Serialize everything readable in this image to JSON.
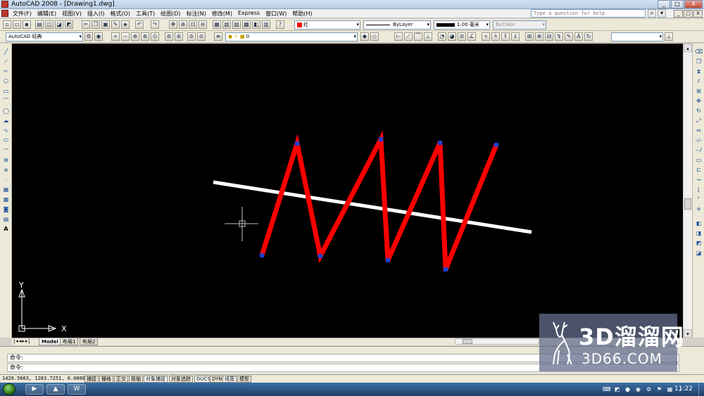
{
  "window": {
    "title": "AutoCAD 2008 - [Drawing1.dwg]",
    "controls": [
      "_",
      "□",
      "X"
    ],
    "mdi_controls": [
      "_",
      "□",
      "X"
    ]
  },
  "menu": {
    "items": [
      "文件(F)",
      "编辑(E)",
      "视图(V)",
      "插入(I)",
      "格式(O)",
      "工具(T)",
      "绘图(D)",
      "标注(N)",
      "修改(M)",
      "Express",
      "窗口(W)",
      "帮助(H)"
    ],
    "help_placeholder": "Type a question for help"
  },
  "toolbar_properties": {
    "color": "红",
    "color_hex": "#ff0000",
    "linetype": "ByLayer",
    "lineweight": "1.00 毫米",
    "plotstyle": "ByColor"
  },
  "toolbar_workspace": {
    "workspace": "AutoCAD 经典",
    "layer": "0"
  },
  "layout_tabs": [
    "Model",
    "布局1",
    "布局2"
  ],
  "command": {
    "line1": "命令:",
    "line2": "命令:"
  },
  "status": {
    "coords": "1420.5663, 1283.7251, 0.0000",
    "toggles": [
      {
        "label": "捕捉",
        "on": false
      },
      {
        "label": "栅格",
        "on": false
      },
      {
        "label": "正交",
        "on": false
      },
      {
        "label": "极轴",
        "on": false
      },
      {
        "label": "对象捕捉",
        "on": true
      },
      {
        "label": "对象追踪",
        "on": false
      },
      {
        "label": "DUCS",
        "on": true
      },
      {
        "label": "DYN",
        "on": false
      },
      {
        "label": "线宽",
        "on": true
      },
      {
        "label": "模型",
        "on": false
      }
    ]
  },
  "ucs": {
    "x_label": "X",
    "y_label": "Y"
  },
  "taskbar": {
    "clock": "11:22"
  },
  "watermark": {
    "brand": "3D溜溜网",
    "url": "3D66.COM"
  },
  "colors": {
    "canvas": "#000000",
    "zigzag": "#ff0000",
    "line": "#ffffff",
    "grip": "#1f3fd1"
  }
}
